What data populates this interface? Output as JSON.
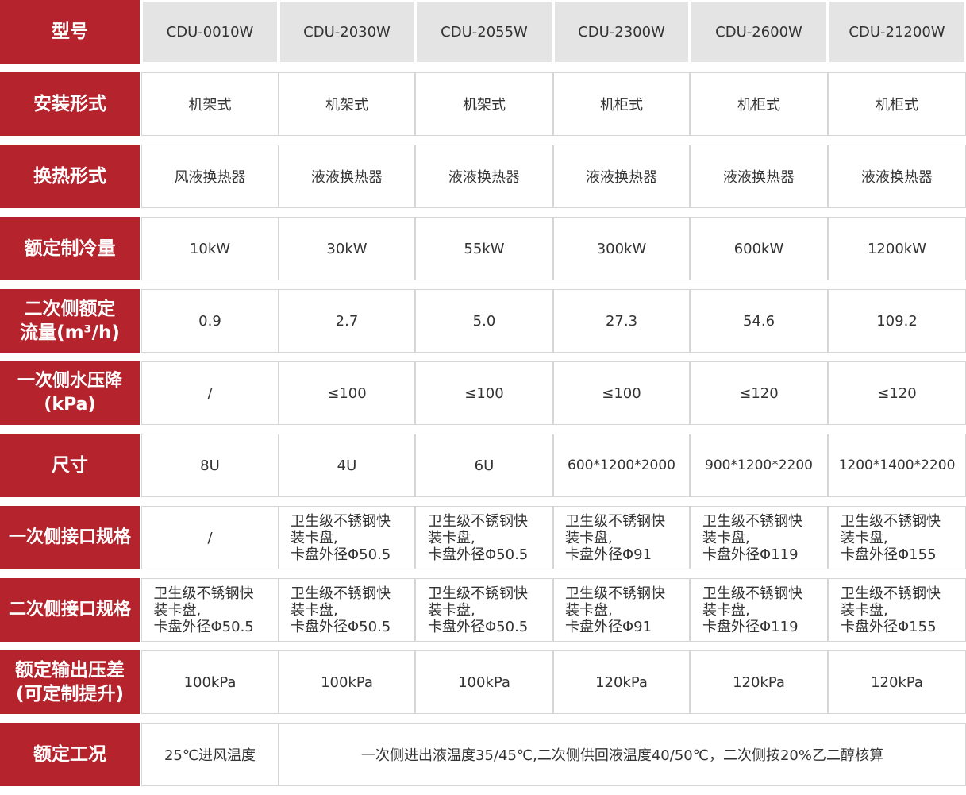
{
  "header": {
    "label": "型号",
    "models": [
      "CDU-0010W",
      "CDU-2030W",
      "CDU-2055W",
      "CDU-2300W",
      "CDU-2600W",
      "CDU-21200W"
    ]
  },
  "rows": {
    "install": {
      "label": "安装形式",
      "values": [
        "机架式",
        "机架式",
        "机架式",
        "机柜式",
        "机柜式",
        "机柜式"
      ]
    },
    "exchange": {
      "label": "换热形式",
      "values": [
        "风液换热器",
        "液液换热器",
        "液液换热器",
        "液液换热器",
        "液液换热器",
        "液液换热器"
      ]
    },
    "cooling": {
      "label": "额定制冷量",
      "values": [
        "10kW",
        "30kW",
        "55kW",
        "300kW",
        "600kW",
        "1200kW"
      ]
    },
    "flow": {
      "label_line1": "二次侧额定",
      "label_line2": "流量(m³/h)",
      "values": [
        "0.9",
        "2.7",
        "5.0",
        "27.3",
        "54.6",
        "109.2"
      ]
    },
    "pressure_drop": {
      "label_line1": "一次侧水压降",
      "label_line2": "(kPa)",
      "values": [
        "/",
        "≤100",
        "≤100",
        "≤100",
        "≤120",
        "≤120"
      ]
    },
    "size": {
      "label": "尺寸",
      "values": [
        "8U",
        "4U",
        "6U",
        "600*1200*2000",
        "900*1200*2200",
        "1200*1400*2200"
      ]
    },
    "primary_port": {
      "label": "一次侧接口规格",
      "col1": "/",
      "values": [
        {
          "line1": "卫生级不锈钢快",
          "line2": "装卡盘,",
          "line3": "卡盘外径Φ50.5"
        },
        {
          "line1": "卫生级不锈钢快",
          "line2": "装卡盘,",
          "line3": "卡盘外径Φ50.5"
        },
        {
          "line1": "卫生级不锈钢快",
          "line2": "装卡盘,",
          "line3": "卡盘外径Φ91"
        },
        {
          "line1": "卫生级不锈钢快",
          "line2": "装卡盘,",
          "line3": "卡盘外径Φ119"
        },
        {
          "line1": "卫生级不锈钢快",
          "line2": "装卡盘,",
          "line3": "卡盘外径Φ155"
        }
      ]
    },
    "secondary_port": {
      "label": "二次侧接口规格",
      "values": [
        {
          "line1": "卫生级不锈钢快",
          "line2": "装卡盘,",
          "line3": "卡盘外径Φ50.5"
        },
        {
          "line1": "卫生级不锈钢快",
          "line2": "装卡盘,",
          "line3": "卡盘外径Φ50.5"
        },
        {
          "line1": "卫生级不锈钢快",
          "line2": "装卡盘,",
          "line3": "卡盘外径Φ50.5"
        },
        {
          "line1": "卫生级不锈钢快",
          "line2": "装卡盘,",
          "line3": "卡盘外径Φ91"
        },
        {
          "line1": "卫生级不锈钢快",
          "line2": "装卡盘,",
          "line3": "卡盘外径Φ119"
        },
        {
          "line1": "卫生级不锈钢快",
          "line2": "装卡盘,",
          "line3": "卡盘外径Φ155"
        }
      ]
    },
    "output_pressure": {
      "label_line1": "额定输出压差",
      "label_line2": "(可定制提升)",
      "values": [
        "100kPa",
        "100kPa",
        "100kPa",
        "120kPa",
        "120kPa",
        "120kPa"
      ]
    },
    "condition": {
      "label": "额定工况",
      "col1": "25℃进风温度",
      "merged": "一次侧进出液温度35/45℃,二次侧供回液温度40/50℃，二次侧按20%乙二醇核算"
    }
  },
  "colors": {
    "label_bg": "#b5232d",
    "header_bg": "#e4e4e4",
    "border": "#d6d6d6"
  }
}
